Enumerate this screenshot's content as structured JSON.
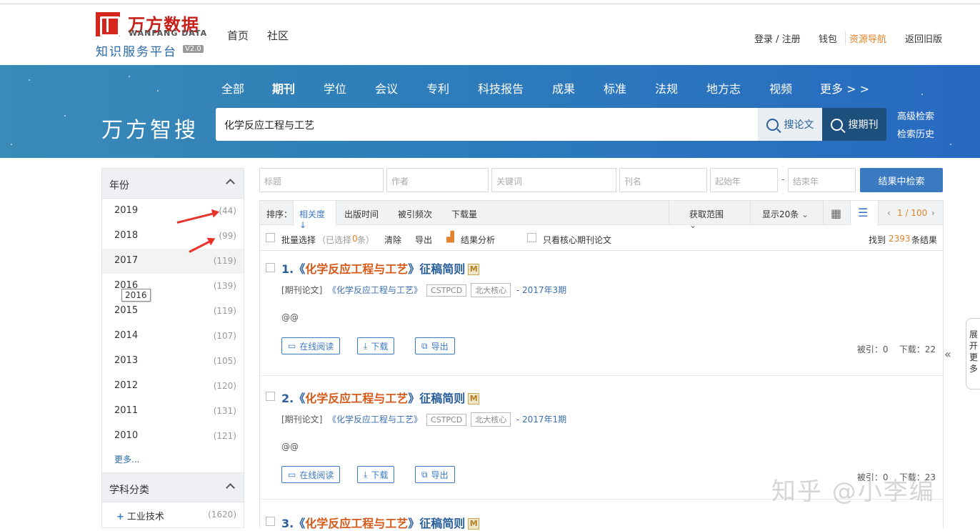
{
  "header": {
    "logo_cn": "万方数据",
    "logo_en": "WANFANG DATA",
    "logo_sub": "知识服务平台",
    "logo_ver": "V2.0",
    "nav": [
      "首页",
      "社区"
    ],
    "links": {
      "login": "登录 / 注册",
      "wallet": "钱包",
      "resource": "资源导航",
      "back": "返回旧版"
    }
  },
  "banner": {
    "categories": [
      "全部",
      "期刊",
      "学位",
      "会议",
      "专利",
      "科技报告",
      "成果",
      "标准",
      "法规",
      "地方志",
      "视频",
      "更多 > >"
    ],
    "active_category": "期刊",
    "brand": "万方智搜",
    "query": "化学反应工程与工艺",
    "btn_paper": "搜论文",
    "btn_journal": "搜期刊",
    "advanced": "高级检索",
    "history": "检索历史"
  },
  "sidebar": {
    "year_header": "年份",
    "years": [
      {
        "year": "2019",
        "count": "(44)"
      },
      {
        "year": "2018",
        "count": "(99)"
      },
      {
        "year": "2017",
        "count": "(119)"
      },
      {
        "year": "2016",
        "count": "(139)"
      },
      {
        "year": "2015",
        "count": "(119)"
      },
      {
        "year": "2014",
        "count": "(107)"
      },
      {
        "year": "2013",
        "count": "(105)"
      },
      {
        "year": "2012",
        "count": "(120)"
      },
      {
        "year": "2011",
        "count": "(131)"
      },
      {
        "year": "2010",
        "count": "(121)"
      }
    ],
    "more": "更多...",
    "tooltip": "2016",
    "subject_header": "学科分类",
    "subject_item": {
      "label": "工业技术",
      "count": "(1620)"
    }
  },
  "filters": {
    "title": "标题",
    "author": "作者",
    "keyword": "关键词",
    "journal": "刊名",
    "start_year": "起始年",
    "dash": "-",
    "end_year": "结束年",
    "search_btn": "结果中检索"
  },
  "sortbar": {
    "label": "排序：",
    "relevance": "相关度",
    "pubtime": "出版时间",
    "cited": "被引频次",
    "downloads": "下载量",
    "range": "获取范围",
    "show": "显示20条",
    "page": "1 / 100"
  },
  "selbar": {
    "batch": "批量选择",
    "selected_pre": "（已选择",
    "selected_n": "0",
    "selected_post": "条）",
    "clear": "清除",
    "export": "导出",
    "analysis": "结果分析",
    "core_only": "只看核心期刊论文",
    "found_pre": "找到",
    "found_n": "2393",
    "found_post": "条结果"
  },
  "results": [
    {
      "num": "1.",
      "prefix": "《",
      "title": "化学反应工程与工艺",
      "suffix": "》征稿简则",
      "type": "[期刊论文]",
      "source": "《化学反应工程与工艺》",
      "tag1": "CSTPCD",
      "tag2": "北大核心",
      "date": "- 2017年3期",
      "abstract": "@@",
      "read": "在线阅读",
      "download": "下载",
      "export": "导出",
      "stat": "被引：0    下载：22"
    },
    {
      "num": "2.",
      "prefix": "《",
      "title": "化学反应工程与工艺",
      "suffix": "》征稿简则",
      "type": "[期刊论文]",
      "source": "《化学反应工程与工艺》",
      "tag1": "CSTPCD",
      "tag2": "北大核心",
      "date": "- 2017年1期",
      "abstract": "@@",
      "read": "在线阅读",
      "download": "下载",
      "export": "导出",
      "stat": "被引：0    下载：23"
    },
    {
      "num": "3.",
      "prefix": "《",
      "title": "化学反应工程与工艺",
      "suffix": "》征稿简则"
    }
  ],
  "side_tab": "展开更多",
  "watermark": "知乎 @小李编",
  "colors": {
    "accent": "#3b79c1",
    "title_red": "#d35a1a",
    "banner": "#2c78bd"
  }
}
